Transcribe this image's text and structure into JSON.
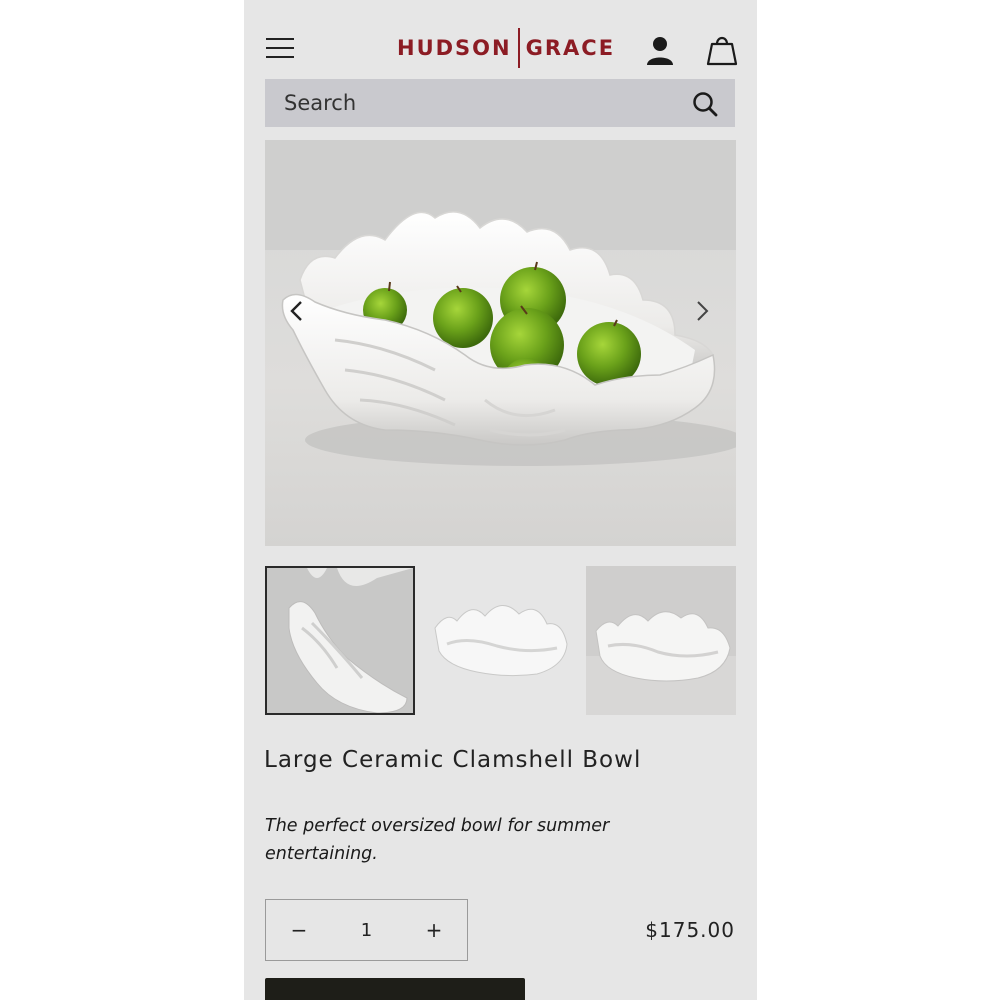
{
  "header": {
    "brand_left": "HUDSON",
    "brand_right": "GRACE",
    "brand_color": "#8c1c24",
    "menu_icon": "hamburger-menu-icon",
    "account_icon": "user-icon",
    "bag_icon": "shopping-bag-icon"
  },
  "search": {
    "placeholder": "Search",
    "icon": "search-icon"
  },
  "gallery": {
    "prev_icon": "chevron-left-icon",
    "next_icon": "chevron-right-icon",
    "selected_thumbnail": 1
  },
  "product": {
    "title": "Large Ceramic Clamshell Bowl",
    "description": "The perfect oversized bowl for summer entertaining.",
    "quantity": "1",
    "minus_label": "−",
    "plus_label": "+",
    "price": "$175.00"
  }
}
